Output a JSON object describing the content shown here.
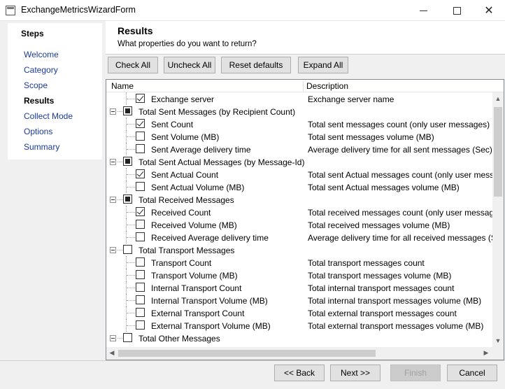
{
  "window": {
    "title": "ExchangeMetricsWizardForm"
  },
  "steps": {
    "title": "Steps",
    "items": [
      {
        "label": "Welcome",
        "active": false
      },
      {
        "label": "Category",
        "active": false
      },
      {
        "label": "Scope",
        "active": false
      },
      {
        "label": "Results",
        "active": true
      },
      {
        "label": "Collect Mode",
        "active": false
      },
      {
        "label": "Options",
        "active": false
      },
      {
        "label": "Summary",
        "active": false
      }
    ]
  },
  "header": {
    "title": "Results",
    "subtitle": "What properties do you want to return?"
  },
  "toolbar": {
    "check_all": "Check All",
    "uncheck_all": "Uncheck All",
    "reset_defaults": "Reset defaults",
    "expand_all": "Expand All"
  },
  "list": {
    "columns": {
      "name": "Name",
      "description": "Description"
    },
    "rows": [
      {
        "level": 1,
        "state": "checked",
        "name": "Exchange server",
        "description": "Exchange server name"
      },
      {
        "level": 0,
        "state": "partial",
        "name": "Total Sent Messages (by Recipient Count)",
        "description": ""
      },
      {
        "level": 1,
        "state": "checked",
        "name": "Sent Count",
        "description": "Total sent messages count (only user messages)"
      },
      {
        "level": 1,
        "state": "unchecked",
        "name": "Sent Volume (MB)",
        "description": "Total sent messages volume (MB)"
      },
      {
        "level": 1,
        "state": "unchecked",
        "name": "Sent Average delivery time",
        "description": "Average delivery time for all sent messages (Sec)"
      },
      {
        "level": 0,
        "state": "partial",
        "name": "Total Sent Actual Messages (by Message-Id)",
        "description": ""
      },
      {
        "level": 1,
        "state": "checked",
        "name": "Sent Actual Count",
        "description": "Total sent Actual messages count (only user messages"
      },
      {
        "level": 1,
        "state": "unchecked",
        "name": "Sent Actual Volume (MB)",
        "description": "Total sent Actual messages volume (MB)"
      },
      {
        "level": 0,
        "state": "partial",
        "name": "Total Received Messages",
        "description": ""
      },
      {
        "level": 1,
        "state": "checked",
        "name": "Received Count",
        "description": "Total received messages count (only user messages)"
      },
      {
        "level": 1,
        "state": "unchecked",
        "name": "Received Volume (MB)",
        "description": "Total received messages volume (MB)"
      },
      {
        "level": 1,
        "state": "unchecked",
        "name": "Received Average delivery time",
        "description": "Average delivery time for all received messages (Sec)"
      },
      {
        "level": 0,
        "state": "unchecked",
        "name": "Total Transport Messages",
        "description": ""
      },
      {
        "level": 1,
        "state": "unchecked",
        "name": "Transport Count",
        "description": "Total transport messages count"
      },
      {
        "level": 1,
        "state": "unchecked",
        "name": "Transport Volume (MB)",
        "description": "Total transport messages volume (MB)"
      },
      {
        "level": 1,
        "state": "unchecked",
        "name": "Internal Transport Count",
        "description": "Total internal transport messages count"
      },
      {
        "level": 1,
        "state": "unchecked",
        "name": "Internal Transport Volume (MB)",
        "description": "Total internal transport messages volume (MB)"
      },
      {
        "level": 1,
        "state": "unchecked",
        "name": "External Transport Count",
        "description": "Total external transport messages count"
      },
      {
        "level": 1,
        "state": "unchecked",
        "name": "External Transport Volume (MB)",
        "description": "Total external transport messages volume (MB)"
      },
      {
        "level": 0,
        "state": "unchecked",
        "name": "Total Other Messages",
        "description": ""
      }
    ]
  },
  "footer": {
    "back": "<< Back",
    "next": "Next >>",
    "finish": "Finish",
    "cancel": "Cancel"
  },
  "colors": {
    "link": "#1a3a9a",
    "window_bg": "#f0f0f0",
    "button_bg": "#e1e1e1",
    "scroll_thumb": "#cdcdcd"
  }
}
